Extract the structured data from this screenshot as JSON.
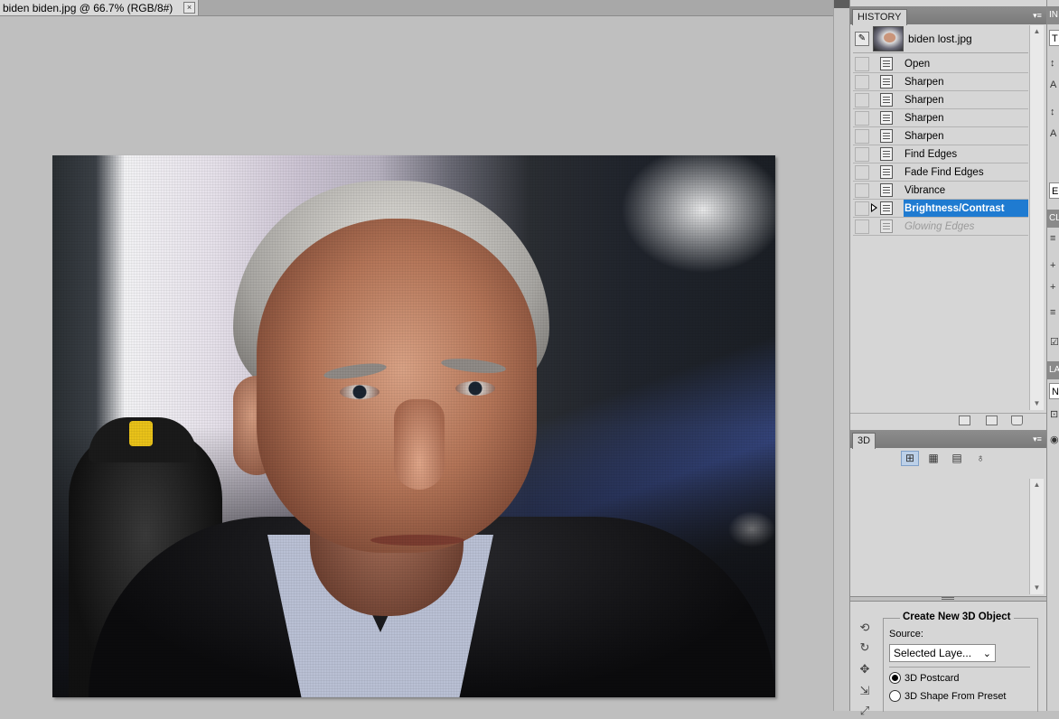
{
  "document": {
    "tab_title": "biden biden.jpg @ 66.7% (RGB/8#)",
    "close_glyph": "×"
  },
  "history_panel": {
    "tab_label": "HISTORY",
    "menu_glyph": "▾≡",
    "snapshot": {
      "label": "biden lost.jpg",
      "icon": "brush-icon"
    },
    "states": [
      {
        "label": "Open",
        "state": "normal"
      },
      {
        "label": "Sharpen",
        "state": "normal"
      },
      {
        "label": "Sharpen",
        "state": "normal"
      },
      {
        "label": "Sharpen",
        "state": "normal"
      },
      {
        "label": "Sharpen",
        "state": "normal"
      },
      {
        "label": "Find Edges",
        "state": "normal"
      },
      {
        "label": "Fade Find Edges",
        "state": "normal"
      },
      {
        "label": "Vibrance",
        "state": "normal"
      },
      {
        "label": "Brightness/Contrast",
        "state": "selected"
      },
      {
        "label": "Glowing Edges",
        "state": "dimmed"
      }
    ],
    "footer_buttons": [
      "new-document-from-state-icon",
      "new-snapshot-icon",
      "delete-state-icon"
    ]
  },
  "panel_3d": {
    "tab_label": "3D",
    "menu_glyph": "▾≡",
    "tools": [
      {
        "name": "scene-icon",
        "glyph": "⊞",
        "active": true
      },
      {
        "name": "meshes-icon",
        "glyph": "▦",
        "active": false
      },
      {
        "name": "materials-icon",
        "glyph": "▤",
        "active": false
      },
      {
        "name": "lights-icon",
        "glyph": "♁",
        "active": false
      }
    ],
    "create": {
      "title": "Create New 3D Object",
      "source_label": "Source:",
      "source_value": "Selected Laye...",
      "options": [
        {
          "label": "3D Postcard",
          "checked": true
        },
        {
          "label": "3D Shape From Preset",
          "checked": false
        }
      ]
    },
    "side_icons": [
      "rotate-3d-icon",
      "roll-3d-icon",
      "drag-3d-icon",
      "slide-3d-icon",
      "scale-3d-icon"
    ]
  },
  "collapsed_strip": {
    "heads": [
      "IN",
      "CL",
      "LA"
    ],
    "fields": [
      "T",
      "E",
      "N"
    ]
  },
  "colors": {
    "selection": "#1f7bd1",
    "workspace": "#bfbfbf",
    "panel": "#d6d6d6"
  }
}
